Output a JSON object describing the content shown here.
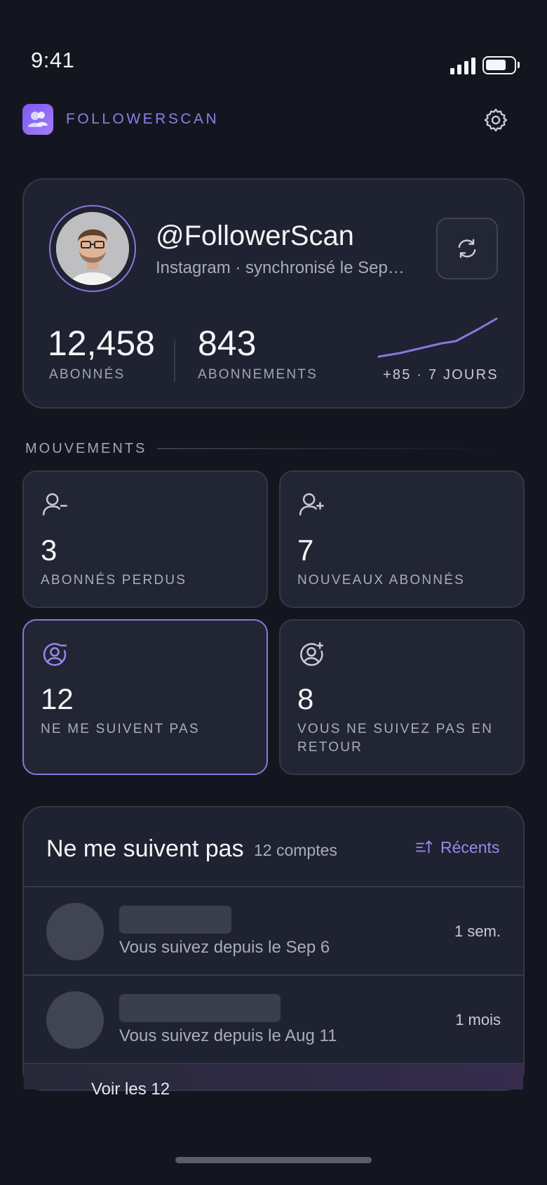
{
  "status_bar": {
    "time": "9:41"
  },
  "header": {
    "brand": "FOLLOWERSCAN"
  },
  "profile": {
    "handle": "@FollowerScan",
    "sync_status": "Instagram · synchronisé le Sep…",
    "followers_count": "12,458",
    "followers_label": "ABONNÉS",
    "following_count": "843",
    "following_label": "ABONNEMENTS",
    "growth": "+85 · 7 JOURS",
    "accent_color": "#8877dd"
  },
  "movements": {
    "section_label": "MOUVEMENTS",
    "cards": [
      {
        "value": "3",
        "label_lines": [
          "ABONNÉS PERDUS"
        ],
        "icon": "user-minus-icon"
      },
      {
        "value": "7",
        "label_lines": [
          "NOUVEAUX ABONNÉS"
        ],
        "icon": "user-plus-icon"
      },
      {
        "value": "12",
        "label_lines": [
          "NE ME SUIVENT PAS"
        ],
        "icon": "user-circle-minus-icon",
        "selected": true
      },
      {
        "value": "8",
        "label_lines": [
          "VOUS NE SUIVEZ PAS EN",
          "RETOUR"
        ],
        "icon": "user-circle-plus-icon"
      }
    ]
  },
  "list": {
    "title": "Ne me suivent pas",
    "count": "12 comptes",
    "sort_label": "Récents",
    "rows": [
      {
        "subtitle": "Vous suivez depuis le Sep 6",
        "time": "1 sem."
      },
      {
        "subtitle": "Vous suivez depuis le Aug 11",
        "time": "1 mois"
      }
    ],
    "footer_text": "Voir les 12"
  }
}
